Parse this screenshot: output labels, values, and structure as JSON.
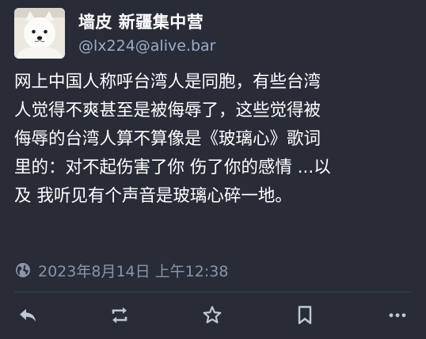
{
  "author": {
    "display_name": "墙皮 新疆集中营",
    "handle": "@lx224@alive.bar"
  },
  "post": {
    "lines": [
      "网上中国人称呼台湾人是同胞，有些台湾",
      "人觉得不爽甚至是被侮辱了，这些觉得被",
      "侮辱的台湾人算不算像是《玻璃心》歌词",
      "里的：对不起伤害了你 伤了你的感情 ...以",
      "及 我听见有个声音是玻璃心碎一地。"
    ],
    "timestamp": "2023年8月14日 上午12:38",
    "visibility_icon": "globe-icon"
  },
  "actions": [
    {
      "name": "reply",
      "icon": "reply-icon"
    },
    {
      "name": "boost",
      "icon": "boost-icon"
    },
    {
      "name": "favourite",
      "icon": "star-icon"
    },
    {
      "name": "bookmark",
      "icon": "bookmark-icon"
    },
    {
      "name": "more",
      "icon": "more-icon"
    }
  ],
  "colors": {
    "background": "#282c37",
    "text": "#ffffff",
    "secondary_text": "#9baec8",
    "muted": "#8d93ab",
    "icon": "#c2c7d6"
  }
}
